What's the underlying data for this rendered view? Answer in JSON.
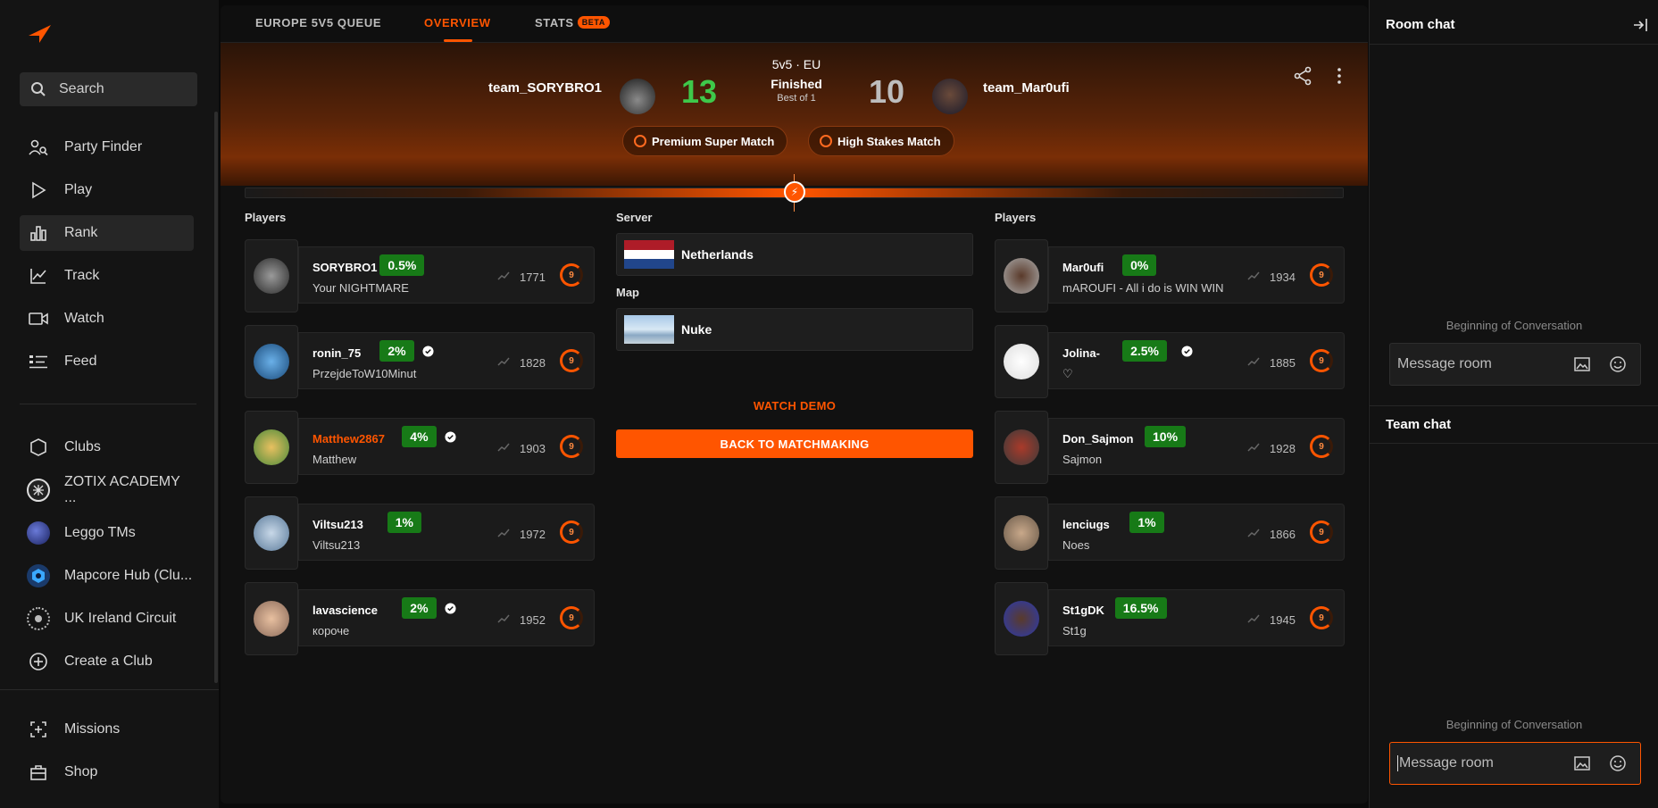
{
  "sidebar": {
    "search_label": "Search",
    "nav": [
      {
        "label": "Party Finder",
        "icon": "party-finder-icon"
      },
      {
        "label": "Play",
        "icon": "play-icon"
      },
      {
        "label": "Rank",
        "icon": "rank-icon",
        "active": true
      },
      {
        "label": "Track",
        "icon": "track-icon"
      },
      {
        "label": "Watch",
        "icon": "watch-icon"
      },
      {
        "label": "Feed",
        "icon": "feed-icon"
      }
    ],
    "clubs": [
      {
        "label": "Clubs",
        "icon": "clubs-icon"
      },
      {
        "label": "ZOTIX ACADEMY ...",
        "icon": "zotix-club-icon"
      },
      {
        "label": "Leggo TMs",
        "icon": "leggo-club-icon"
      },
      {
        "label": "Mapcore Hub (Clu...",
        "icon": "mapcore-club-icon"
      },
      {
        "label": "UK Ireland Circuit",
        "icon": "uk-ireland-club-icon"
      },
      {
        "label": "Create a Club",
        "icon": "plus-circle-icon"
      }
    ],
    "bottom": [
      {
        "label": "Missions",
        "icon": "missions-icon"
      },
      {
        "label": "Shop",
        "icon": "shop-icon"
      }
    ]
  },
  "tabs": {
    "queue": "EUROPE 5V5 QUEUE",
    "overview": "OVERVIEW",
    "stats": "STATS",
    "beta": "BETA"
  },
  "match": {
    "mode": "5v5 · EU",
    "status": "Finished",
    "best_of": "Best of 1",
    "team1": {
      "name": "team_SORYBRO1",
      "score": "13"
    },
    "team2": {
      "name": "team_Mar0ufi",
      "score": "10"
    },
    "badges": [
      "Premium Super Match",
      "High Stakes Match"
    ],
    "accent": "#ff5500",
    "win_color": "#3ec84a"
  },
  "labels": {
    "players_left": "Players",
    "players_right": "Players",
    "server": "Server",
    "map": "Map",
    "server_value": "Netherlands",
    "map_value": "Nuke",
    "watch_demo": "WATCH DEMO",
    "back": "BACK TO MATCHMAKING"
  },
  "team1_players": [
    {
      "nick": "SORYBRO1",
      "pct": "0.5%",
      "sub": "Your NIGHTMARE",
      "elo": "1771",
      "level": "9",
      "verified": false,
      "highlight": false
    },
    {
      "nick": "ronin_75",
      "pct": "2%",
      "sub": "PrzejdeToW10Minut",
      "elo": "1828",
      "level": "9",
      "verified": true,
      "highlight": false
    },
    {
      "nick": "Matthew2867",
      "pct": "4%",
      "sub": "Matthew",
      "elo": "1903",
      "level": "9",
      "verified": true,
      "highlight": true
    },
    {
      "nick": "Viltsu213",
      "pct": "1%",
      "sub": "Viltsu213",
      "elo": "1972",
      "level": "9",
      "verified": false,
      "highlight": false
    },
    {
      "nick": "lavascience",
      "pct": "2%",
      "sub": "короче",
      "elo": "1952",
      "level": "9",
      "verified": true,
      "highlight": false
    }
  ],
  "team2_players": [
    {
      "nick": "Mar0ufi",
      "pct": "0%",
      "sub": "mAROUFI - All i do is WIN WIN",
      "elo": "1934",
      "level": "9",
      "verified": false,
      "highlight": false
    },
    {
      "nick": "Jolina-",
      "pct": "2.5%",
      "sub": "♡",
      "elo": "1885",
      "level": "9",
      "verified": true,
      "highlight": false
    },
    {
      "nick": "Don_Sajmon",
      "pct": "10%",
      "sub": "Sajmon",
      "elo": "1928",
      "level": "9",
      "verified": false,
      "highlight": false
    },
    {
      "nick": "lenciugs",
      "pct": "1%",
      "sub": "Noes",
      "elo": "1866",
      "level": "9",
      "verified": false,
      "highlight": false
    },
    {
      "nick": "St1gDK",
      "pct": "16.5%",
      "sub": "St1g",
      "elo": "1945",
      "level": "9",
      "verified": false,
      "highlight": false
    }
  ],
  "chat": {
    "room_title": "Room chat",
    "team_title": "Team chat",
    "beginning": "Beginning of Conversation",
    "placeholder": "Message room"
  }
}
